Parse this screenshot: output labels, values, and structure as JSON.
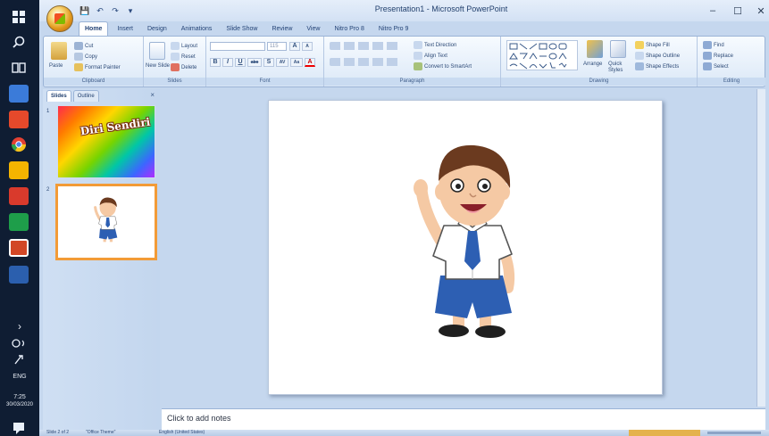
{
  "window": {
    "title": "Presentation1 - Microsoft PowerPoint",
    "minimize": "–",
    "maximize": "☐",
    "close": "✕"
  },
  "taskbar": {
    "chevron": "›",
    "language": "ENG",
    "time": "7:25",
    "date": "30/03/2020"
  },
  "quick_access": [
    "💾",
    "↶",
    "↷",
    "▾"
  ],
  "tabs": [
    "Home",
    "Insert",
    "Design",
    "Animations",
    "Slide Show",
    "Review",
    "View",
    "Nitro Pro 8",
    "Nitro Pro 9"
  ],
  "ribbon": {
    "clipboard": {
      "label": "Clipboard",
      "paste": "Paste",
      "cut": "Cut",
      "copy": "Copy",
      "format_painter": "Format Painter"
    },
    "slides": {
      "label": "Slides",
      "new_slide": "New Slide",
      "layout": "Layout",
      "reset": "Reset",
      "delete": "Delete"
    },
    "font": {
      "label": "Font",
      "size": "115",
      "grow": "A",
      "shrink": "A",
      "bold": "B",
      "italic": "I",
      "underline": "U",
      "strike": "abc",
      "shadow": "S",
      "spacing": "AV",
      "case": "Aa",
      "color": "A"
    },
    "paragraph": {
      "label": "Paragraph",
      "text_direction": "Text Direction",
      "align_text": "Align Text",
      "smartart": "Convert to SmartArt"
    },
    "drawing": {
      "label": "Drawing",
      "arrange": "Arrange",
      "quick_styles": "Quick Styles",
      "shape_fill": "Shape Fill",
      "shape_outline": "Shape Outline",
      "shape_effects": "Shape Effects"
    },
    "editing": {
      "label": "Editing",
      "find": "Find",
      "replace": "Replace",
      "select": "Select"
    }
  },
  "pane": {
    "tab_slides": "Slides",
    "tab_outline": "Outline",
    "close": "×",
    "slide1_num": "1",
    "slide2_num": "2",
    "slide1_title": "Diri Sendiri"
  },
  "notes": {
    "placeholder": "Click to add notes"
  },
  "status": {
    "slide_count": "Slide 2 of 2",
    "theme": "\"Office Theme\"",
    "language": "English (United States)"
  },
  "colors": {
    "ribbon_blue": "#c5d7ee",
    "taskbar": "#0f1d33",
    "thumb_border_selected": "#f29b37",
    "shirt": "#ffffff",
    "shorts": "#2d5fb3",
    "hair": "#6b3a1f",
    "skin": "#f5c9a4"
  }
}
